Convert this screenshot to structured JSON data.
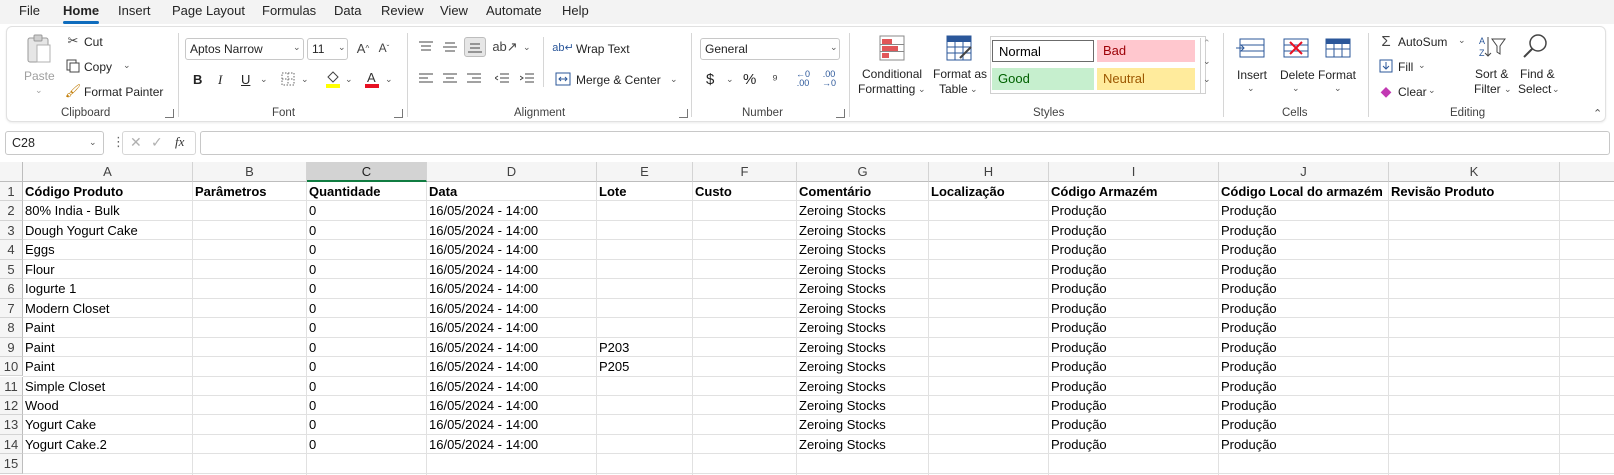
{
  "menu": {
    "tabs": [
      "File",
      "Home",
      "Insert",
      "Page Layout",
      "Formulas",
      "Data",
      "Review",
      "View",
      "Automate",
      "Help"
    ],
    "active": "Home"
  },
  "ribbon": {
    "clipboard": {
      "paste": "Paste",
      "cut": "Cut",
      "copy": "Copy",
      "format_painter": "Format Painter",
      "group": "Clipboard"
    },
    "font": {
      "family": "Aptos Narrow",
      "size": "11",
      "bold": "B",
      "italic": "I",
      "underline": "U",
      "group": "Font"
    },
    "alignment": {
      "wrap_text": "Wrap Text",
      "merge_center": "Merge & Center",
      "group": "Alignment"
    },
    "number": {
      "format": "General",
      "currency": "$",
      "percent": "%",
      "group": "Number"
    },
    "styles": {
      "conditional_formatting_1": "Conditional",
      "conditional_formatting_2": "Formatting",
      "format_as_table_1": "Format as",
      "format_as_table_2": "Table",
      "normal": "Normal",
      "bad": "Bad",
      "good": "Good",
      "neutral": "Neutral",
      "group": "Styles",
      "colors": {
        "bad_bg": "#ffc7ce",
        "bad_fg": "#9c0006",
        "good_bg": "#c6efce",
        "good_fg": "#006100",
        "neutral_bg": "#ffeb9c",
        "neutral_fg": "#9c5700"
      }
    },
    "cells": {
      "insert": "Insert",
      "delete": "Delete",
      "format": "Format",
      "group": "Cells"
    },
    "editing": {
      "autosum": "AutoSum",
      "fill": "Fill",
      "clear": "Clear",
      "sort_filter_1": "Sort &",
      "sort_filter_2": "Filter",
      "find_select_1": "Find &",
      "find_select_2": "Select",
      "group": "Editing"
    }
  },
  "formula_bar": {
    "name_box": "C28",
    "fx": "fx",
    "formula": ""
  },
  "grid": {
    "columns": [
      "A",
      "B",
      "C",
      "D",
      "E",
      "F",
      "G",
      "H",
      "I",
      "J",
      "K"
    ],
    "selected_column": "C",
    "row_numbers": [
      "1",
      "2",
      "3",
      "4",
      "5",
      "6",
      "7",
      "8",
      "9",
      "10",
      "11",
      "12",
      "13",
      "14",
      "15"
    ],
    "header_row": [
      "Código Produto",
      "Parâmetros",
      "Quantidade",
      "Data",
      "Lote",
      "Custo",
      "Comentário",
      "Localização",
      "Código Armazém",
      "Código Local do armazém",
      "Revisão Produto"
    ],
    "rows": [
      [
        "80% India - Bulk",
        "",
        "0",
        "16/05/2024 - 14:00",
        "",
        "",
        "Zeroing Stocks",
        "",
        "Produção",
        "Produção",
        ""
      ],
      [
        "Dough Yogurt Cake",
        "",
        "0",
        "16/05/2024 - 14:00",
        "",
        "",
        "Zeroing Stocks",
        "",
        "Produção",
        "Produção",
        ""
      ],
      [
        "Eggs",
        "",
        "0",
        "16/05/2024 - 14:00",
        "",
        "",
        "Zeroing Stocks",
        "",
        "Produção",
        "Produção",
        ""
      ],
      [
        "Flour",
        "",
        "0",
        "16/05/2024 - 14:00",
        "",
        "",
        "Zeroing Stocks",
        "",
        "Produção",
        "Produção",
        ""
      ],
      [
        "Iogurte 1",
        "",
        "0",
        "16/05/2024 - 14:00",
        "",
        "",
        "Zeroing Stocks",
        "",
        "Produção",
        "Produção",
        ""
      ],
      [
        "Modern Closet",
        "",
        "0",
        "16/05/2024 - 14:00",
        "",
        "",
        "Zeroing Stocks",
        "",
        "Produção",
        "Produção",
        ""
      ],
      [
        "Paint",
        "",
        "0",
        "16/05/2024 - 14:00",
        "",
        "",
        "Zeroing Stocks",
        "",
        "Produção",
        "Produção",
        ""
      ],
      [
        "Paint",
        "",
        "0",
        "16/05/2024 - 14:00",
        "P203",
        "",
        "Zeroing Stocks",
        "",
        "Produção",
        "Produção",
        ""
      ],
      [
        "Paint",
        "",
        "0",
        "16/05/2024 - 14:00",
        "P205",
        "",
        "Zeroing Stocks",
        "",
        "Produção",
        "Produção",
        ""
      ],
      [
        "Simple Closet",
        "",
        "0",
        "16/05/2024 - 14:00",
        "",
        "",
        "Zeroing Stocks",
        "",
        "Produção",
        "Produção",
        ""
      ],
      [
        "Wood",
        "",
        "0",
        "16/05/2024 - 14:00",
        "",
        "",
        "Zeroing Stocks",
        "",
        "Produção",
        "Produção",
        ""
      ],
      [
        "Yogurt Cake",
        "",
        "0",
        "16/05/2024 - 14:00",
        "",
        "",
        "Zeroing Stocks",
        "",
        "Produção",
        "Produção",
        ""
      ],
      [
        "Yogurt Cake.2",
        "",
        "0",
        "16/05/2024 - 14:00",
        "",
        "",
        "Zeroing Stocks",
        "",
        "Produção",
        "Produção",
        ""
      ]
    ]
  }
}
